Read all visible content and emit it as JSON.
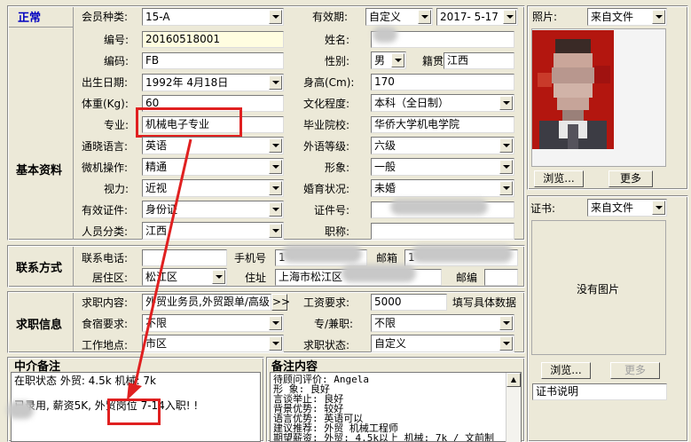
{
  "status": "正常",
  "sections": {
    "basic": "基本资料",
    "contact": "联系方式",
    "job": "求职信息",
    "agent_notes": "中介备注",
    "notes": "备注内容"
  },
  "form": {
    "member_type": {
      "label": "会员种类:",
      "value": "15-A"
    },
    "validity": {
      "label": "有效期:",
      "value": "自定义",
      "date": "2017- 5-17"
    },
    "number": {
      "label": "编号:",
      "value": "20160518001"
    },
    "name": {
      "label": "姓名:"
    },
    "code": {
      "label": "编码:",
      "value": "FB"
    },
    "gender": {
      "label": "性别:",
      "value": "男"
    },
    "native": {
      "label": "籍贯",
      "value": "江西"
    },
    "birth": {
      "label": "出生日期:",
      "value": "1992年 4月18日"
    },
    "height": {
      "label": "身高(Cm):",
      "value": "170"
    },
    "weight": {
      "label": "体重(Kg):",
      "value": "60"
    },
    "education": {
      "label": "文化程度:",
      "value": "本科（全日制）"
    },
    "major": {
      "label": "专业:",
      "value": "机械电子专业"
    },
    "school": {
      "label": "毕业院校:",
      "value": "华侨大学机电学院"
    },
    "language": {
      "label": "通晓语言:",
      "value": "英语"
    },
    "foreign_level": {
      "label": "外语等级:",
      "value": "六级"
    },
    "computer": {
      "label": "微机操作:",
      "value": "精通"
    },
    "image": {
      "label": "形象:",
      "value": "一般"
    },
    "vision": {
      "label": "视力:",
      "value": "近视"
    },
    "marital": {
      "label": "婚育状况:",
      "value": "未婚"
    },
    "id_type": {
      "label": "有效证件:",
      "value": "身份证"
    },
    "id_number": {
      "label": "证件号:"
    },
    "category": {
      "label": "人员分类:",
      "value": "江西"
    },
    "title": {
      "label": "职称:"
    },
    "phone": {
      "label": "联系电话:"
    },
    "mobile": {
      "label": "手机号"
    },
    "mobile_prefix": "1",
    "mailbox": {
      "label": "邮箱"
    },
    "mailbox_prefix": "1",
    "district": {
      "label": "居住区:",
      "value": "松江区"
    },
    "address": {
      "label": "住址",
      "value": "上海市松江区"
    },
    "postcode": {
      "label": "邮编"
    },
    "job_content": {
      "label": "求职内容:",
      "value": "外贸业务员,外贸跟单/高级",
      "btn": ">>"
    },
    "salary": {
      "label": "工资要求:",
      "value": "5000",
      "hint": "填写具体数据"
    },
    "board": {
      "label": "食宿要求:",
      "value": "不限"
    },
    "parttime": {
      "label": "专/兼职:",
      "value": "不限"
    },
    "location": {
      "label": "工作地点:",
      "value": "市区"
    },
    "job_status": {
      "label": "求职状态:",
      "value": "自定义"
    }
  },
  "photo": {
    "label": "照片:",
    "source": "来自文件",
    "browse": "浏览...",
    "more": "更多"
  },
  "cert": {
    "label": "证书:",
    "source": "来自文件",
    "no_image": "没有图片",
    "browse": "浏览...",
    "more": "更多",
    "desc_placeholder": "证书说明"
  },
  "agent_notes": [
    "在职状态 外贸: 4.5k  机械: 7k",
    "",
    "  已录用, 薪资5K, 外贸岗位  7-14入职! !"
  ],
  "notes_lines": [
    "待顾问评价: Angela",
    "形    象: 良好",
    "言谈举止: 良好",
    "背景优势: 较好",
    "语言优势: 英语可以",
    "建议推荐: 外贸 机械工程师",
    "期望薪资: 外贸: 4.5k以上   机械: 7k / 文前制"
  ],
  "highlight_color": "#e02020"
}
